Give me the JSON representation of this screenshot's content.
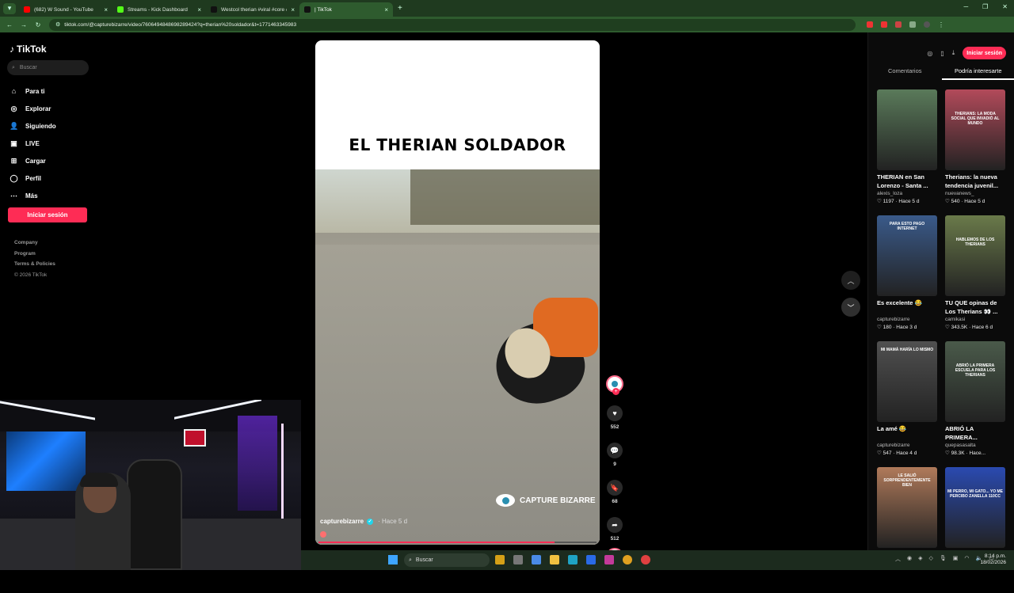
{
  "browser": {
    "tabs": [
      {
        "title": "(682) W Sound - YouTube",
        "color": "#ff0000"
      },
      {
        "title": "Streams - Kick Dashboard",
        "color": "#53fc18"
      },
      {
        "title": "Westcol therian #viral #core #ci",
        "color": "#111111"
      },
      {
        "title": "| TikTok",
        "color": "#111111",
        "active": true
      }
    ],
    "url": "tiktok.com/@capturebizarre/video/7606494848698289424?q=therian%20soldador&t=1771463345983"
  },
  "sidebar": {
    "logo": "TikTok",
    "search_placeholder": "Buscar",
    "nav": [
      {
        "label": "Para ti",
        "icon": "home-icon"
      },
      {
        "label": "Explorar",
        "icon": "compass-icon"
      },
      {
        "label": "Siguiendo",
        "icon": "user-plus-icon"
      },
      {
        "label": "LIVE",
        "icon": "live-icon"
      },
      {
        "label": "Cargar",
        "icon": "upload-icon"
      },
      {
        "label": "Perfil",
        "icon": "profile-icon"
      },
      {
        "label": "Más",
        "icon": "more-icon"
      }
    ],
    "login_label": "Iniciar sesión",
    "footer": [
      "Company",
      "Program",
      "Terms & Policies"
    ],
    "copyright": "© 2026 TikTok"
  },
  "video": {
    "overlay_title": "EL THERIAN SOLDADOR",
    "watermark": "CAPTURE BIZARRE",
    "author": "capturebizarre",
    "time": "· Hace 5 d",
    "progress": 0.85
  },
  "actions": {
    "likes": "552",
    "comments": "9",
    "saves": "68",
    "shares": "512"
  },
  "right_panel": {
    "login_label": "Iniciar sesión",
    "tabs": [
      "Comentarios",
      "Podría interesarte"
    ],
    "active_tab": 1,
    "cards": [
      {
        "title": "THERIAN en San Lorenzo - Santa ...",
        "author": "alexis_loza",
        "likes": "1197",
        "time": "Hace 5 d",
        "thumb_caption": "",
        "color": "#5a7a5a"
      },
      {
        "title": "Therians: la nueva tendencia juvenil...",
        "author": "nuevanews_",
        "likes": "540",
        "time": "Hace 5 d",
        "thumb_caption": "THERIANS: LA MODA SOCIAL QUE INVADIÓ AL MUNDO",
        "color": "#b24a5a"
      },
      {
        "title": "Es excelente 😂",
        "author": "capturebizarre",
        "likes": "180",
        "time": "Hace 3 d",
        "thumb_caption": "PARA ESTO PAGO INTERNET",
        "color": "#3a5a8a"
      },
      {
        "title": "TU QUE opinas de Los Therians 👀 ...",
        "author": "camikasi",
        "likes": "343.5K",
        "time": "Hace 6 d",
        "thumb_caption": "HABLEMOS DE LOS THERIANS",
        "color": "#6a7a4a"
      },
      {
        "title": "La amé 😂",
        "author": "capturebizarre",
        "likes": "547",
        "time": "Hace 4 d",
        "thumb_caption": "MI MAMÁ HARÍA LO MISMO",
        "color": "#505050"
      },
      {
        "title": "ABRIÓ LA PRIMERA...",
        "author": "quepasasalta",
        "likes": "98.3K",
        "time": "Hace...",
        "thumb_caption": "ABRIÓ LA PRIMERA ESCUELA PARA LOS THERIANS",
        "color": "#4a5a4a"
      },
      {
        "title": "",
        "author": "",
        "likes": "",
        "time": "",
        "thumb_caption": "LE SALIÓ SORPRENDENTEMENTE BIEN",
        "color": "#b07a5a"
      },
      {
        "title": "",
        "author": "",
        "likes": "",
        "time": "",
        "thumb_caption": "MI PERRO, MI GATO... YO ME PERCIBO ZANELLA 110CC",
        "color": "#2a4ab0"
      }
    ]
  },
  "taskbar": {
    "search_placeholder": "Buscar",
    "time": "8:14 p.m.",
    "date": "18/02/2026"
  }
}
